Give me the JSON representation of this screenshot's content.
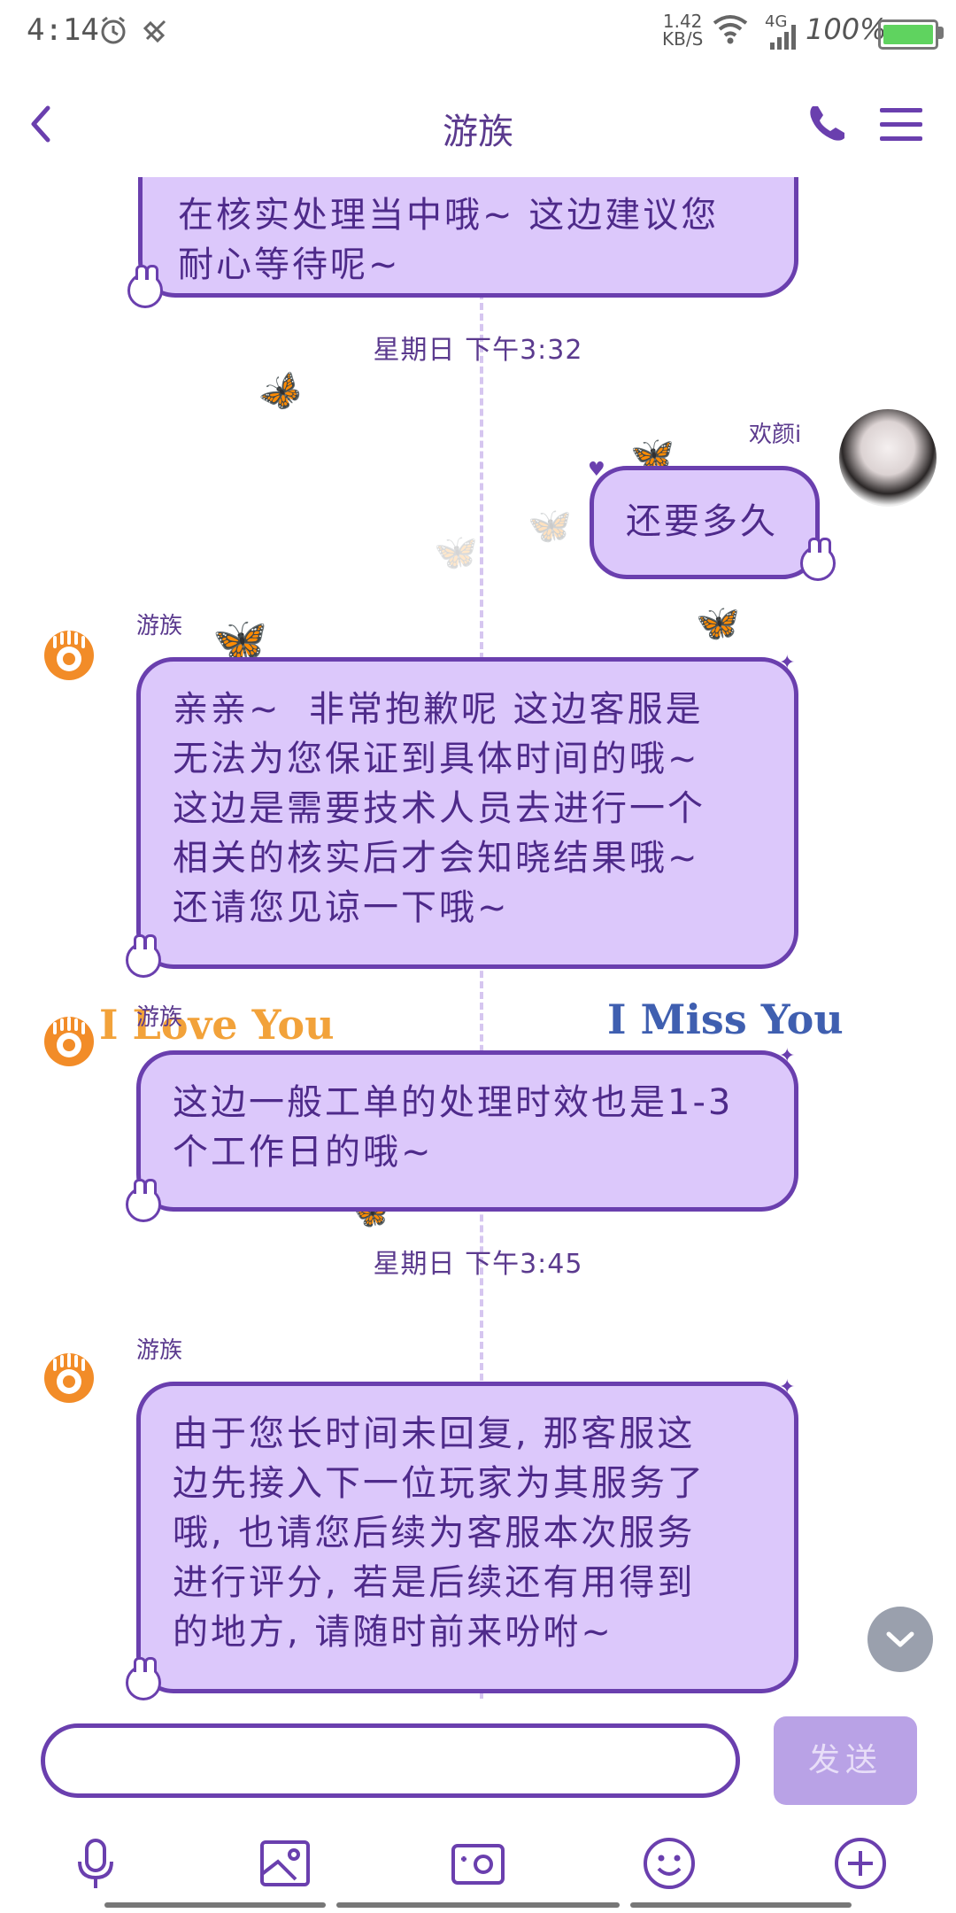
{
  "status_bar": {
    "time": "4:14",
    "net_speed_value": "1.42",
    "net_speed_unit": "KB/S",
    "network_type": "4G",
    "battery": "100%",
    "icons": [
      "alarm-icon",
      "do-not-disturb-icon",
      "wifi-icon",
      "signal-icon",
      "battery-icon"
    ]
  },
  "header": {
    "title": "游族",
    "icons": [
      "back-icon",
      "phone-icon",
      "menu-icon"
    ]
  },
  "chat": {
    "messages": [
      {
        "sender": "cs",
        "text": "在核实处理当中哦~ 这边建议您\n耐心等待呢~"
      },
      {
        "type": "timestamp",
        "text": "星期日 下午3:32"
      },
      {
        "sender": "user",
        "name": "欢颜i",
        "text": "还要多久"
      },
      {
        "sender": "cs",
        "name": "游族",
        "text": "亲亲~  非常抱歉呢 这边客服是\n无法为您保证到具体时间的哦~\n这边是需要技术人员去进行一个\n相关的核实后才会知晓结果哦~\n还请您见谅一下哦~"
      },
      {
        "sender": "cs",
        "name": "游族",
        "text": "这边一般工单的处理时效也是1-3\n个工作日的哦~"
      },
      {
        "type": "timestamp",
        "text": "星期日 下午3:45"
      },
      {
        "sender": "cs",
        "name": "游族",
        "text": "由于您长时间未回复, 那客服这\n边先接入下一位玩家为其服务了\n哦, 也请您后续为客服本次服务\n进行评分, 若是后续还有用得到\n的地方, 请随时前来吩咐~"
      }
    ],
    "decorations": {
      "love_text": "I Love You",
      "miss_text": "I Miss You"
    }
  },
  "input": {
    "value": "",
    "send_label": "发送"
  },
  "toolbar": [
    "microphone-icon",
    "image-icon",
    "camera-icon",
    "emoji-icon",
    "plus-icon"
  ],
  "colors": {
    "accent": "#6a3fae",
    "bubble": "#dcc8fb",
    "send_disabled": "#b9a2e6",
    "cs_avatar": "#f28c28"
  }
}
